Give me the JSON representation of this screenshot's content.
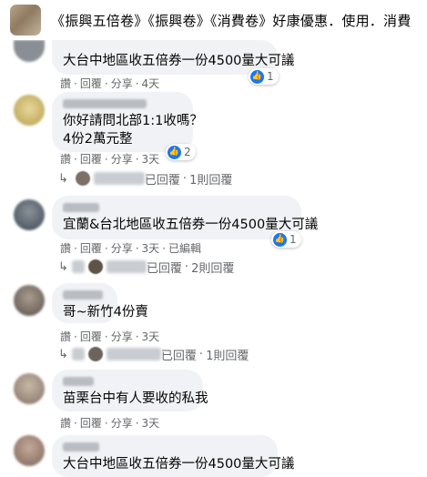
{
  "header": {
    "title": "《振興五倍卷》《振興卷》《消費卷》好康優惠．使用．消費"
  },
  "comments": [
    {
      "text_lines": [
        "大台中地區收五倍券一份4500量大可議"
      ],
      "reaction": {
        "icon": "like-icon",
        "count": "1"
      },
      "actions": {
        "like": "讚",
        "reply": "回覆",
        "share": "分享",
        "time": "4天"
      }
    },
    {
      "text_lines": [
        "你好請問北部1:1收嗎？",
        "4份2萬元整"
      ],
      "reaction": {
        "icon": "like-icon",
        "count": "2"
      },
      "actions": {
        "like": "讚",
        "reply": "回覆",
        "share": "分享",
        "time": "3天"
      },
      "replies_summary": {
        "suffix": "已回覆",
        "count_text": "1則回覆"
      }
    },
    {
      "text_lines": [
        "宜蘭&台北地區收五倍券一份4500量大可議"
      ],
      "reaction": {
        "icon": "like-icon",
        "count": "1"
      },
      "actions": {
        "like": "讚",
        "reply": "回覆",
        "share": "分享",
        "time": "3天",
        "edited": "已編輯"
      },
      "replies_summary": {
        "suffix": "已回覆",
        "count_text": "2則回覆"
      }
    },
    {
      "text_lines": [
        "哥~新竹4份賣"
      ],
      "actions": {
        "like": "讚",
        "reply": "回覆",
        "share": "分享",
        "time": "3天"
      },
      "replies_summary": {
        "suffix": "已回覆",
        "count_text": "1則回覆"
      }
    },
    {
      "text_lines": [
        "苗栗台中有人要收的私我"
      ],
      "actions": {
        "like": "讚",
        "reply": "回覆",
        "share": "分享",
        "time": "3天"
      }
    },
    {
      "text_lines": [
        "大台中地區收五倍券一份4500量大可議"
      ]
    }
  ],
  "colors": {
    "bubble": "#f0f2f5",
    "like_blue": "#1877f2",
    "meta_gray": "#65676b"
  }
}
